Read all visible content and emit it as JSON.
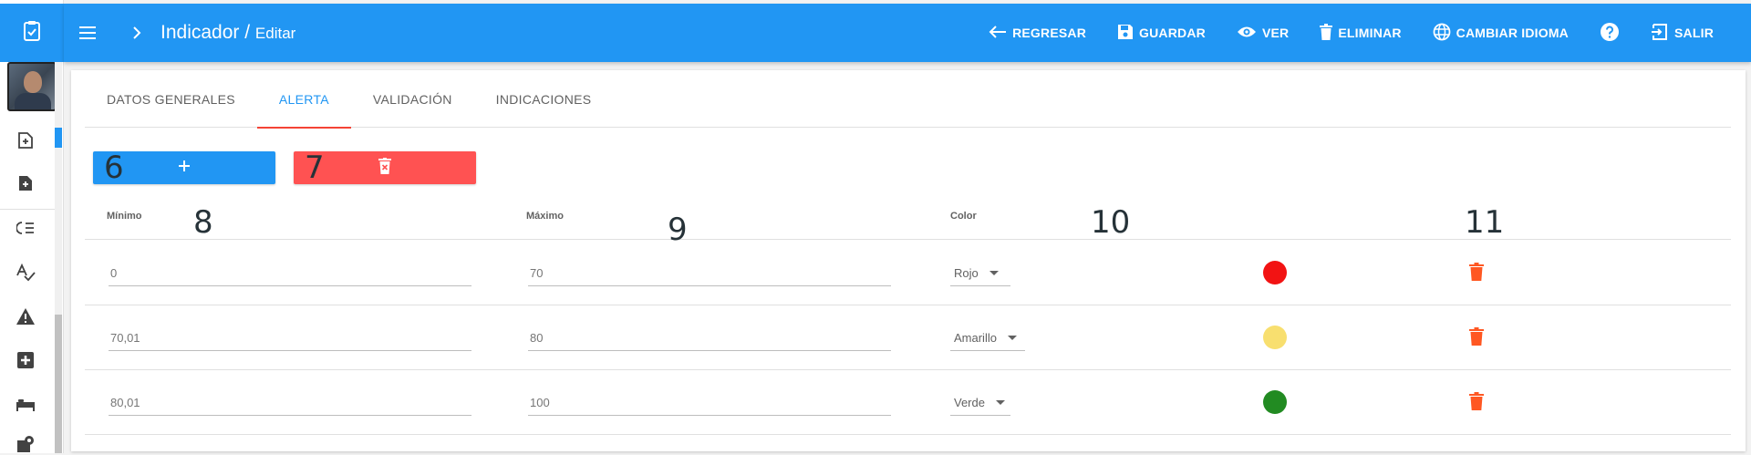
{
  "header": {
    "title": "Indicador",
    "separator": " / ",
    "subtitle": "Editar",
    "actions": [
      {
        "label": "REGRESAR",
        "icon": "arrow-left-icon"
      },
      {
        "label": "GUARDAR",
        "icon": "save-icon"
      },
      {
        "label": "VER",
        "icon": "eye-icon"
      },
      {
        "label": "ELIMINAR",
        "icon": "trash-icon"
      },
      {
        "label": "CAMBIAR IDIOMA",
        "icon": "globe-icon"
      },
      {
        "label": "",
        "icon": "help-icon"
      },
      {
        "label": "SALIR",
        "icon": "exit-icon"
      }
    ]
  },
  "tabs": [
    {
      "label": "DATOS GENERALES",
      "active": false
    },
    {
      "label": "ALERTA",
      "active": true
    },
    {
      "label": "VALIDACIÓN",
      "active": false
    },
    {
      "label": "INDICACIONES",
      "active": false
    }
  ],
  "buttons": {
    "add_marker": "6",
    "delete_marker": "7"
  },
  "table": {
    "headers": {
      "min": "Mínimo",
      "max": "Máximo",
      "color": "Color"
    },
    "markers": {
      "min": "8",
      "max": "9",
      "color": "10",
      "actions": "11"
    },
    "rows": [
      {
        "min": "0",
        "max": "70",
        "color_label": "Rojo",
        "color_hex": "#f21313"
      },
      {
        "min": "70,01",
        "max": "80",
        "color_label": "Amarillo",
        "color_hex": "#f8df6f"
      },
      {
        "min": "80,01",
        "max": "100",
        "color_label": "Verde",
        "color_hex": "#228b22"
      }
    ]
  },
  "colors": {
    "primary": "#2196f3",
    "danger": "#ff5252",
    "trash_icon": "#ff5722"
  }
}
